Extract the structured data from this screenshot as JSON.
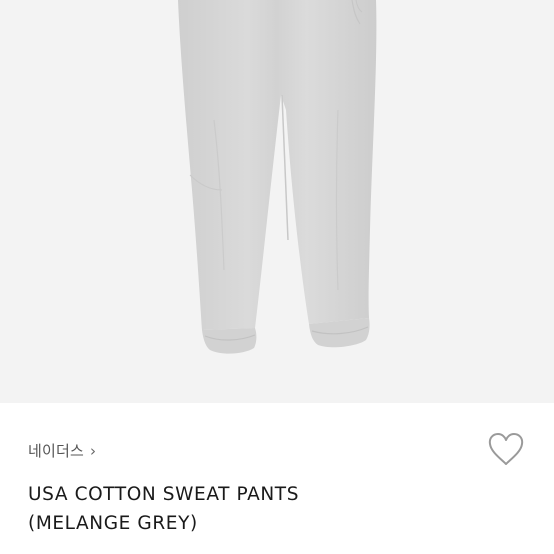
{
  "product": {
    "image_alt": "sweat pants",
    "brand_label": "네이더스",
    "brand_chevron": "›",
    "title": "USA COTTON SWEAT PANTS\n(MELANGE GREY)"
  },
  "icons": {
    "wishlist": "heart-outline-icon",
    "brand_link": "chevron-right-icon"
  },
  "colors": {
    "image_background": "#f3f3f3",
    "pants": "#d6d6d6",
    "text_primary": "#1a1a1a",
    "text_secondary": "#555555",
    "heart_stroke": "#9a9a9a"
  }
}
